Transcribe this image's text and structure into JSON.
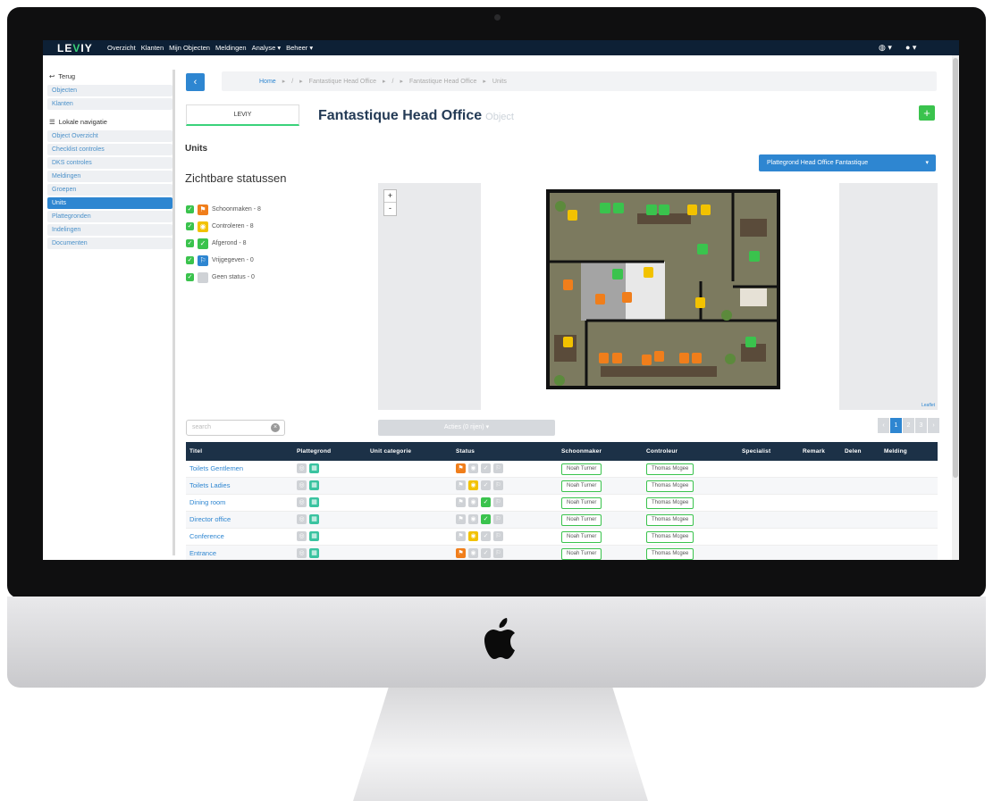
{
  "app": {
    "logo": "LEVIY"
  },
  "nav": {
    "items": [
      "Overzicht",
      "Klanten",
      "Mijn Objecten",
      "Meldingen",
      "Analyse ▾",
      "Beheer ▾"
    ]
  },
  "sidebar": {
    "back_label": "Terug",
    "group1": [
      "Objecten",
      "Klanten"
    ],
    "local_nav_label": "Lokale navigatie",
    "items": [
      "Object Overzicht",
      "Checklist controles",
      "DKS controles",
      "Meldingen",
      "Groepen",
      "Units",
      "Plattegronden",
      "Indelingen",
      "Documenten"
    ],
    "active": "Units"
  },
  "breadcrumb": {
    "home": "Home",
    "items": [
      "/",
      "Fantastique Head Office",
      "/",
      "Fantastique Head Office",
      "Units"
    ]
  },
  "object": {
    "logo_text": "LEVIY",
    "title": "Fantastique Head Office",
    "subtitle": "Object"
  },
  "section": {
    "label": "Units"
  },
  "floorplan_dropdown": {
    "value": "Plattegrond Head Office Fantastique"
  },
  "statuses": {
    "title": "Zichtbare statussen",
    "items": [
      {
        "label": "Schoonmaken - 8",
        "color": "#f07e1b",
        "icon": "cleaning-icon"
      },
      {
        "label": "Controleren - 8",
        "color": "#f2c200",
        "icon": "eye-icon"
      },
      {
        "label": "Afgerond - 8",
        "color": "#3ac34d",
        "icon": "check-icon"
      },
      {
        "label": "Vrijgegeven - 0",
        "color": "#2e86d1",
        "icon": "flag-icon"
      },
      {
        "label": "Geen status - 0",
        "color": "#cfd2d6",
        "icon": "empty-icon"
      }
    ]
  },
  "map": {
    "zoom_in": "+",
    "zoom_out": "-",
    "attribution": "Leaflet"
  },
  "search": {
    "placeholder": "search"
  },
  "actions": {
    "label": "Acties (0 rijen) ▾"
  },
  "pager": {
    "prev": "‹",
    "pages": [
      "1",
      "2",
      "3"
    ],
    "next": "›"
  },
  "table": {
    "columns": [
      "Titel",
      "Plattegrond",
      "Unit categorie",
      "Status",
      "Schoonmaker",
      "Controleur",
      "Specialist",
      "Remark",
      "Delen",
      "Melding"
    ],
    "rows": [
      {
        "title": "Toilets Gentlemen",
        "active_status": "cleaning",
        "cleaner": "Noah Turner",
        "controller": "Thomas Mcgee"
      },
      {
        "title": "Toilets Ladies",
        "active_status": "check",
        "cleaner": "Noah Turner",
        "controller": "Thomas Mcgee"
      },
      {
        "title": "Dining room",
        "active_status": "done",
        "cleaner": "Noah Turner",
        "controller": "Thomas Mcgee"
      },
      {
        "title": "Director office",
        "active_status": "done",
        "cleaner": "Noah Turner",
        "controller": "Thomas Mcgee"
      },
      {
        "title": "Conference",
        "active_status": "check",
        "cleaner": "Noah Turner",
        "controller": "Thomas Mcgee"
      },
      {
        "title": "Entrance",
        "active_status": "cleaning",
        "cleaner": "Noah Turner",
        "controller": "Thomas Mcgee"
      }
    ]
  },
  "colors": {
    "brand_dark": "#0d2035",
    "accent": "#2e86d1",
    "success": "#3ac34d",
    "warning": "#f2c200",
    "orange": "#f07e1b"
  }
}
